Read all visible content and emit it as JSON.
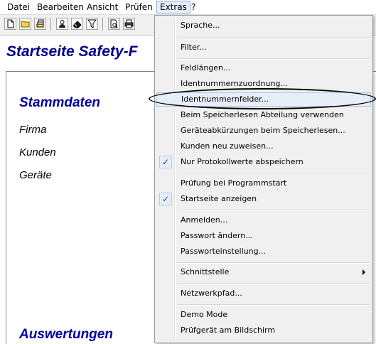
{
  "menubar": {
    "items": [
      "Datei",
      "Bearbeiten",
      "Ansicht",
      "Prüfen",
      "Extras",
      "?"
    ],
    "active": "Extras"
  },
  "toolbar": {
    "buttons": [
      "new-document-icon",
      "open-folder-icon",
      "save-stack-icon",
      "person-icon",
      "eraser-icon",
      "filter-icon",
      "print-preview-icon",
      "printer-icon"
    ]
  },
  "main": {
    "title": "Startseite  Safety-F",
    "stammdaten": {
      "heading": "Stammdaten",
      "items": [
        "Firma",
        "Kunden",
        "Geräte"
      ]
    },
    "auswertungen": {
      "heading": "Auswertungen"
    }
  },
  "extras_menu": {
    "items": [
      {
        "label": "Sprache...",
        "checked": false
      },
      {
        "label": "Filter...",
        "checked": false
      },
      {
        "label": "Feldlängen...",
        "checked": false
      },
      {
        "label": "Identnummernzuordnung...",
        "checked": false
      },
      {
        "label": "Identnummernfelder...",
        "checked": false,
        "highlighted": true
      },
      {
        "label": "Beim Speicherlesen Abteilung verwenden",
        "checked": false
      },
      {
        "label": "Geräteabkürzungen beim Speicherlesen...",
        "checked": false
      },
      {
        "label": "Kunden neu zuweisen...",
        "checked": false
      },
      {
        "label": "Nur Protokollwerte abspeichern",
        "checked": true
      },
      {
        "label": "Prüfung bei Programmstart",
        "checked": false
      },
      {
        "label": "Startseite anzeigen",
        "checked": true
      },
      {
        "label": "Anmelden...",
        "checked": false
      },
      {
        "label": "Passwort ändern...",
        "checked": false
      },
      {
        "label": "Passworteinstellung...",
        "checked": false
      },
      {
        "label": "Schnittstelle",
        "checked": false,
        "submenu": true
      },
      {
        "label": "Netzwerkpfad...",
        "checked": false
      },
      {
        "label": "Demo Mode",
        "checked": false
      },
      {
        "label": "Prüfgerät am Bildschirm",
        "checked": false
      }
    ],
    "check_glyph": "✓"
  },
  "colors": {
    "title_blue": "#00008b",
    "section_blue": "#0000a0",
    "menu_bg": "#f0f0f0",
    "hover_bg": "#e8eef7",
    "hover_border": "#aac4e8"
  }
}
